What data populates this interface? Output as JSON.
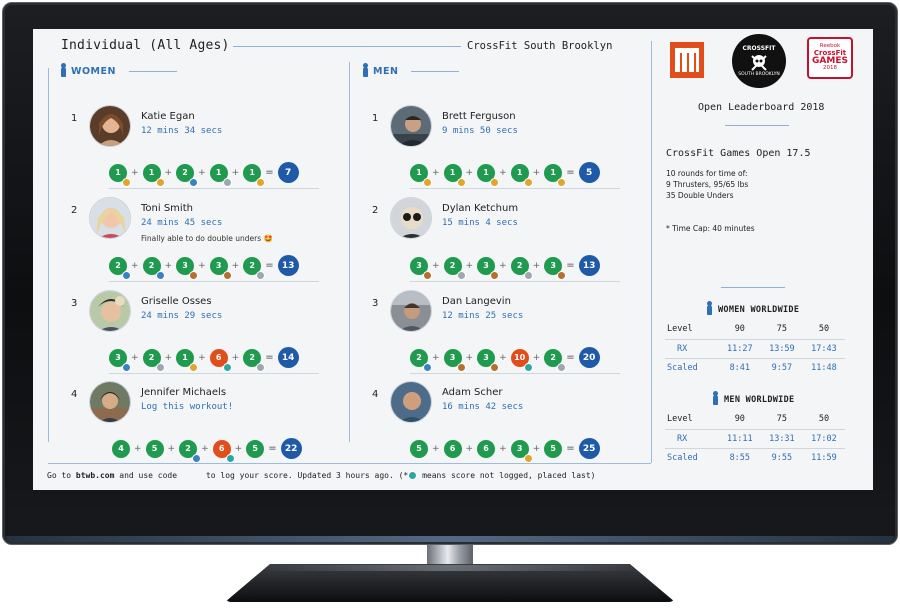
{
  "board": {
    "title": "Individual (All Ages)",
    "gym": "CrossFit South Brooklyn"
  },
  "women": {
    "header": "WOMEN",
    "athletes": [
      {
        "rank": "1",
        "name": "Katie Egan",
        "score": "12 mins 34 secs",
        "comment": "",
        "workouts": [
          "1",
          "1",
          "2",
          "1",
          "1"
        ],
        "total": "7"
      },
      {
        "rank": "2",
        "name": "Toni Smith",
        "score": "24 mins 45 secs",
        "comment": "Finally able to do double unders 🤩",
        "workouts": [
          "2",
          "2",
          "3",
          "3",
          "2"
        ],
        "total": "13"
      },
      {
        "rank": "3",
        "name": "Griselle Osses",
        "score": "24 mins 29 secs",
        "comment": "",
        "workouts": [
          "3",
          "2",
          "1",
          "6",
          "2"
        ],
        "total": "14"
      },
      {
        "rank": "4",
        "name": "Jennifer Michaels",
        "score": "Log this workout!",
        "comment": "",
        "workouts": [
          "4",
          "5",
          "2",
          "6",
          "5"
        ],
        "total": "22"
      }
    ]
  },
  "men": {
    "header": "MEN",
    "athletes": [
      {
        "rank": "1",
        "name": "Brett Ferguson",
        "score": "9 mins 50 secs",
        "comment": "",
        "workouts": [
          "1",
          "1",
          "1",
          "1",
          "1"
        ],
        "total": "5"
      },
      {
        "rank": "2",
        "name": "Dylan Ketchum",
        "score": "15 mins 4 secs",
        "comment": "",
        "workouts": [
          "3",
          "2",
          "3",
          "2",
          "3"
        ],
        "total": "13"
      },
      {
        "rank": "3",
        "name": "Dan Langevin",
        "score": "12 mins 25 secs",
        "comment": "",
        "workouts": [
          "2",
          "3",
          "3",
          "10",
          "2"
        ],
        "total": "20"
      },
      {
        "rank": "4",
        "name": "Adam Scher",
        "score": "16 mins 42 secs",
        "comment": "",
        "workouts": [
          "5",
          "6",
          "6",
          "3",
          "5"
        ],
        "total": "25"
      }
    ]
  },
  "logos": {
    "csb_line1": "CROSSFIT",
    "csb_line2": "SOUTH BROOKLYN",
    "games_line1": "Reebok",
    "games_line2": "CrossFit",
    "games_line3": "GAMES",
    "games_line4": "2018"
  },
  "panel": {
    "title": "Open Leaderboard 2018",
    "wod_name": "CrossFit Games Open 17.5",
    "wod_lines": [
      "10 rounds for time of:",
      "9 Thrusters, 95/65 lbs",
      "35 Double Unders"
    ],
    "timecap": "* Time Cap: 40 minutes",
    "women_ww": {
      "header": "WOMEN WORLDWIDE",
      "levels": [
        "Level",
        "90",
        "75",
        "50"
      ],
      "rx": [
        "RX",
        "11:27",
        "13:59",
        "17:43"
      ],
      "scaled": [
        "Scaled",
        "8:41",
        "9:57",
        "11:48"
      ]
    },
    "men_ww": {
      "header": "MEN WORLDWIDE",
      "levels": [
        "Level",
        "90",
        "75",
        "50"
      ],
      "rx": [
        "RX",
        "11:11",
        "13:31",
        "17:02"
      ],
      "scaled": [
        "Scaled",
        "8:55",
        "9:55",
        "11:59"
      ]
    }
  },
  "footer": {
    "pre": "Go to ",
    "site": "btwb.com",
    "post": " and use code      to log your score. Updated 3 hours ago. (*",
    "tail": " means score not logged, placed last)"
  },
  "colors": {
    "green": "#1f9a4e",
    "orange": "#e24e1b",
    "blue": "#1e5aa8",
    "accent": "#2f6fb3"
  }
}
